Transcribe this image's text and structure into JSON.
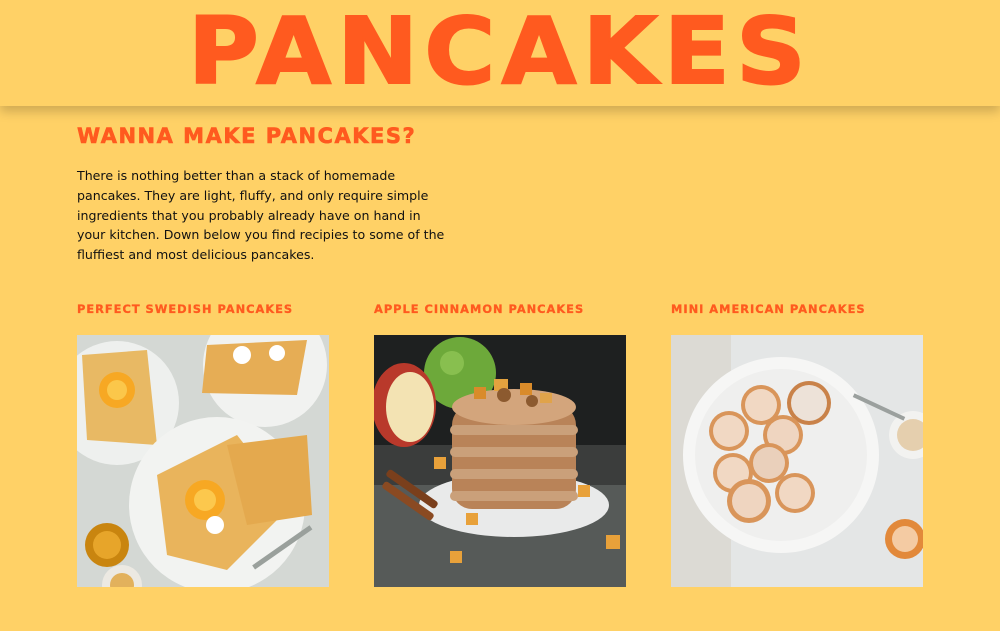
{
  "header": {
    "title": "PANCAKES"
  },
  "intro": {
    "heading": "WANNA MAKE PANCAKES?",
    "text": "There is nothing better than a stack of homemade pancakes. They are light, fluffy, and only require simple ingredients that you probably already have on hand in your kitchen. Down below you find recipies to some of the fluffiest and most delicious pancakes."
  },
  "recipes": [
    {
      "title": "PERFECT SWEDISH PANCAKES",
      "image": "swedish-pancakes-photo"
    },
    {
      "title": "APPLE CINNAMON PANCAKES",
      "image": "apple-cinnamon-pancakes-photo"
    },
    {
      "title": "MINI AMERICAN PANCAKES",
      "image": "mini-american-pancakes-photo"
    }
  ],
  "colors": {
    "background": "#ffd166",
    "accent": "#ff5a1f",
    "text": "#111111"
  }
}
